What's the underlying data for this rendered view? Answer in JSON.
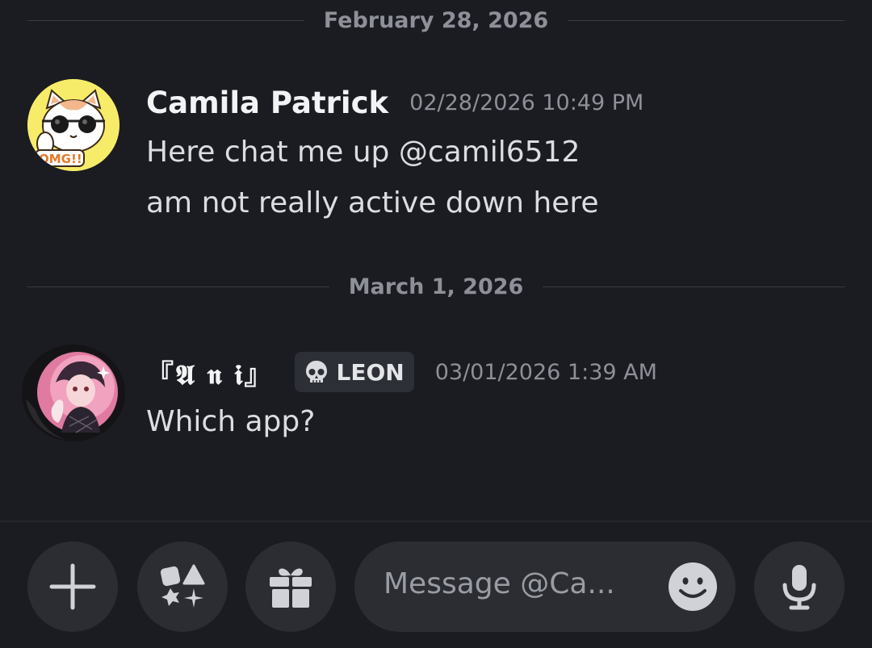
{
  "dividers": [
    {
      "label": "February 28, 2026"
    },
    {
      "label": "March 1, 2026"
    }
  ],
  "messages": [
    {
      "username": "Camila Patrick",
      "timestamp": "02/28/2026 10:49 PM",
      "avatar_icon": "cat-sunglasses-avatar",
      "avatar_text": "OMG!!",
      "lines": [
        "Here chat me up @camil6512",
        "am not really active down here"
      ]
    },
    {
      "username": "『𝕬 𝖓 𝖎』",
      "role_tag": "LEON",
      "role_icon": "skull-icon",
      "timestamp": "03/01/2026 1:39 AM",
      "avatar_icon": "anime-character-avatar",
      "lines": [
        "Which app?"
      ]
    }
  ],
  "composer": {
    "placeholder": "Message @Ca...",
    "buttons": [
      "plus-icon",
      "apps-icon",
      "gift-icon",
      "emoji-icon",
      "microphone-icon"
    ]
  },
  "colors": {
    "background": "#1b1c21",
    "button_bg": "#2b2d33",
    "muted_text": "#8e9099",
    "avatar1_bg": "#f7ec6a"
  }
}
